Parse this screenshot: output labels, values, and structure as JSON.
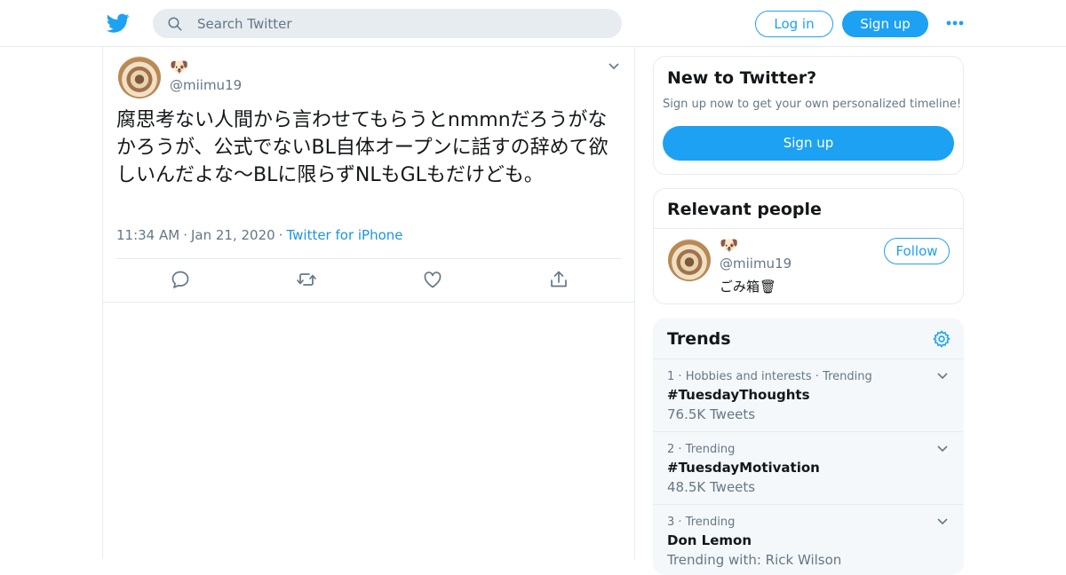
{
  "header": {
    "search_placeholder": "Search Twitter",
    "login_label": "Log in",
    "signup_label": "Sign up",
    "more_icon": "more-dots-icon",
    "logo_icon": "twitter-bird-icon"
  },
  "tweet": {
    "display_name_emoji": "🐶",
    "handle": "@miimu19",
    "text": "腐思考ない人間から言わせてもらうとnmmnだろうがなかろうが、公式でないBL自体オープンに話すの辞めて欲しいんだよな〜BLに限らずNLもGLもだけども。",
    "time": "11:34 AM",
    "date": "Jan 21, 2020",
    "source": "Twitter for iPhone",
    "actions": [
      "reply-icon",
      "retweet-icon",
      "like-icon",
      "share-icon"
    ]
  },
  "new_to_twitter": {
    "title": "New to Twitter?",
    "subtitle": "Sign up now to get your own personalized timeline!",
    "signup_label": "Sign up"
  },
  "relevant_people": {
    "title": "Relevant people",
    "person": {
      "display_name_emoji": "🐶",
      "handle": "@miimu19",
      "bio": "ごみ箱🗑",
      "follow_label": "Follow"
    }
  },
  "trends": {
    "title": "Trends",
    "items": [
      {
        "rank": "1",
        "context": "Hobbies and interests",
        "status": "Trending",
        "name": "#TuesdayThoughts",
        "count": "76.5K Tweets"
      },
      {
        "rank": "2",
        "context": "",
        "status": "Trending",
        "name": "#TuesdayMotivation",
        "count": "48.5K Tweets"
      },
      {
        "rank": "3",
        "context": "",
        "status": "Trending",
        "name": "Don Lemon",
        "count": "Trending with: Rick Wilson"
      }
    ]
  },
  "colors": {
    "accent": "#1da1f2",
    "muted": "#657786",
    "border": "#e6ecf0",
    "trends_bg": "#f5f8fa"
  }
}
